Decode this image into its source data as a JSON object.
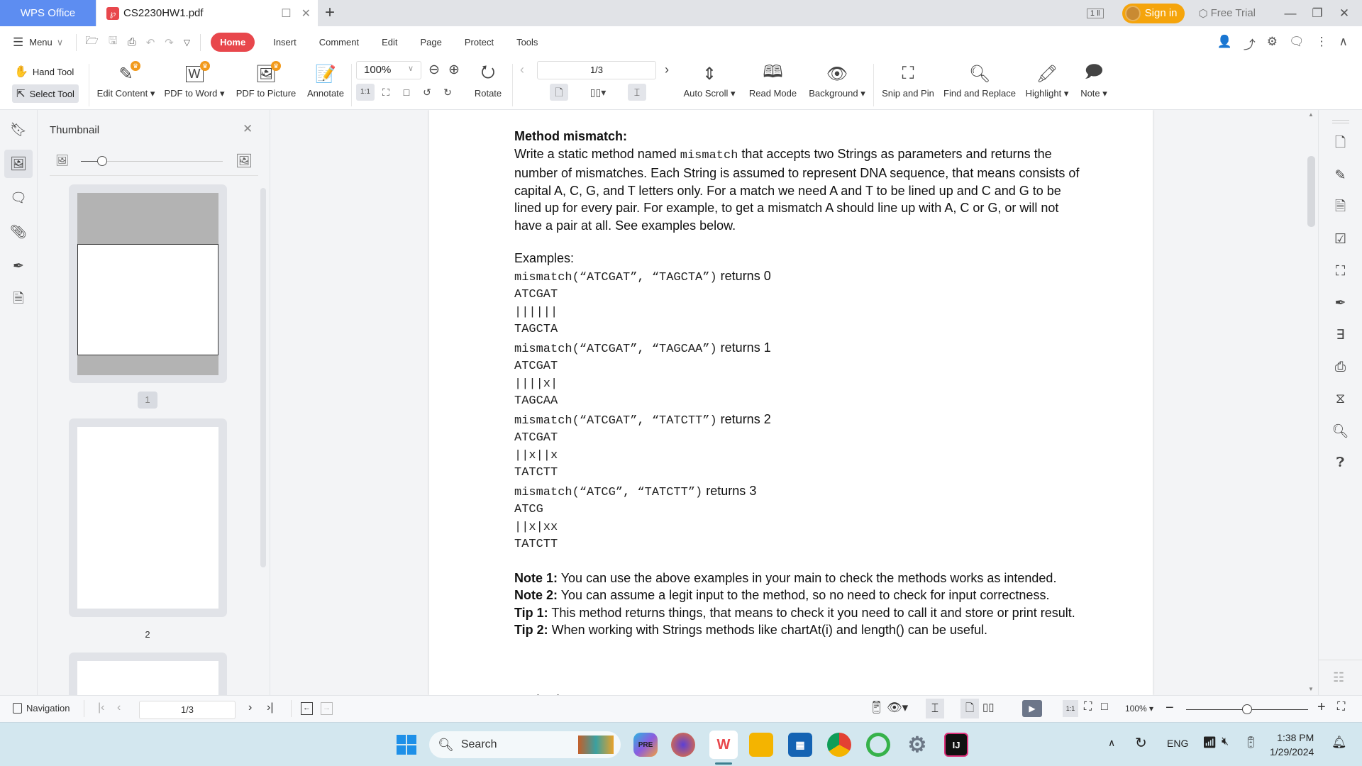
{
  "titlebar": {
    "app_tab": "WPS Office",
    "doc_tab": "CS2230HW1.pdf",
    "new_tab_icon": "plus-icon",
    "page_badge": "1",
    "sign_in": "Sign in",
    "free_trial": "Free Trial"
  },
  "menu": {
    "menu_label": "Menu",
    "tabs": [
      "Home",
      "Insert",
      "Comment",
      "Edit",
      "Page",
      "Protect",
      "Tools"
    ],
    "active_tab": "Home"
  },
  "toolbar": {
    "hand_tool": "Hand Tool",
    "select_tool": "Select Tool",
    "edit_content": "Edit Content",
    "pdf_to_word": "PDF to Word",
    "pdf_to_picture": "PDF to Picture",
    "annotate": "Annotate",
    "zoom_value": "100%",
    "rotate": "Rotate",
    "page_value": "1/3",
    "auto_scroll": "Auto Scroll",
    "read_mode": "Read Mode",
    "background": "Background",
    "snip_and_pin": "Snip and Pin",
    "find_and_replace": "Find and Replace",
    "highlight": "Highlight",
    "note": "Note"
  },
  "thumbnail_panel": {
    "title": "Thumbnail",
    "size_slider_value": 0.15,
    "pages": [
      "1",
      "2"
    ],
    "active_page": "1"
  },
  "document": {
    "heading1": "Method mismatch:",
    "para_prefix": "Write a static method named ",
    "para_code": "mismatch",
    "para_rest": " that accepts two Strings as parameters and returns the number of mismatches. Each String is assumed to represent DNA sequence, that means consists of capital A, C, G, and T letters only. For a match we need A and T to be lined up and C and G to be lined up for every pair. For example, to get a mismatch A should line up with A, C or G, or will not have a pair at all. See examples below.",
    "examples_label": "Examples:",
    "examples": [
      {
        "call": "mismatch(“ATCGAT”, “TAGCTA”)",
        "returns_label": "returns",
        "result": "0",
        "line1": "ATCGAT",
        "align": "||||||",
        "line2": "TAGCTA"
      },
      {
        "call": "mismatch(“ATCGAT”, “TAGCAA”)",
        "returns_label": "returns",
        "result": "1",
        "line1": "ATCGAT",
        "align": "||||x|",
        "line2": "TAGCAA"
      },
      {
        "call": "mismatch(“ATCGAT”, “TATCTT”)",
        "returns_label": "returns",
        "result": "2",
        "line1": "ATCGAT",
        "align": "||x||x",
        "line2": "TATCTT"
      },
      {
        "call": "mismatch(“ATCG”, “TATCTT”)",
        "returns_label": "returns",
        "result": "3",
        "line1": "ATCG",
        "align": "||x|xx",
        "line2": "TATCTT"
      }
    ],
    "notes": [
      {
        "label": "Note 1:",
        "text": " You can use the above examples in your main to check the methods works as intended."
      },
      {
        "label": "Note 2:",
        "text": " You can assume a legit input to the method, so no need to check for input correctness."
      },
      {
        "label": "Tip 1:",
        "text": " This method returns things, that means to check it you need to call it and store or print result."
      },
      {
        "label": "Tip 2:",
        "text": " When working with Strings methods like chartAt(i) and length() can be useful."
      }
    ],
    "heading2": "Method removeZeros:"
  },
  "statusbar": {
    "navigation": "Navigation",
    "page_value": "1/3",
    "zoom_value": "100%",
    "zoom_slider_value": 0.5
  },
  "taskbar": {
    "search_placeholder": "Search",
    "language": "ENG",
    "time": "1:38 PM",
    "date": "1/29/2024"
  },
  "colors": {
    "wps_blue": "#5d8df1",
    "home_red": "#e8474c",
    "sign_in_orange": "#f5a40b",
    "taskbar_bg": "#d3e7ef"
  }
}
